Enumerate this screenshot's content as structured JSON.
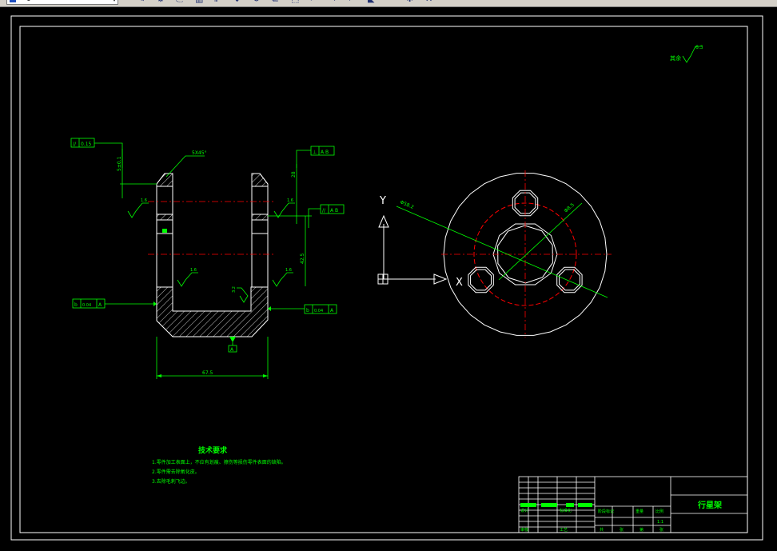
{
  "toolbar": {
    "layer_value": "0",
    "icons": [
      "pencil-icon",
      "gear-icon",
      "match-properties-icon",
      "copy-icon",
      "mirror-icon",
      "move-icon",
      "rotate-icon",
      "scale-icon",
      "stretch-icon",
      "trim-icon",
      "extend-icon",
      "break-icon",
      "chamfer-icon",
      "fillet-icon",
      "explode-icon",
      "erase-icon"
    ]
  },
  "drawing": {
    "colors": {
      "background": "#000000",
      "frame": "#ffffff",
      "dimension": "#00ff00",
      "centerline": "#ff0000",
      "hatch": "#ffffff"
    },
    "roughness_note": {
      "label": "其余",
      "value": "6.3"
    },
    "section_view": {
      "gdt_top_left": {
        "symbol": "//",
        "value": "0.15"
      },
      "gdt_top_right": {
        "symbol": "⊥",
        "value": "A B"
      },
      "gdt_mid_right": {
        "symbol": "//",
        "value": "A B"
      },
      "gdt_left": {
        "symbol": "b",
        "value": "0.04",
        "datum": "A"
      },
      "gdt_right": {
        "symbol": "b",
        "value": "0.04",
        "datum": "A"
      },
      "chamfer_label": "5X45°",
      "dim_left_height": "5±0.1",
      "dim_right_height": "28",
      "dim_right_vertical": "42.5",
      "dim_bottom_width": "67.5",
      "roughness_values": [
        "1.6",
        "1.6",
        "1.6",
        "1.6",
        "3.2"
      ],
      "datum_label": "A"
    },
    "plan_view": {
      "ucs_y": "Y",
      "ucs_x": "X",
      "dim_diameter": "Φ58.2",
      "dim_small": "Φ8.5"
    },
    "tech_requirements": {
      "title": "技术要求",
      "lines": [
        "1.零件加工表面上，不应有划痕、擦伤等损伤零件表面的缺陷。",
        "2.零件需去除氧化皮。",
        "3.去除毛刺飞边。"
      ]
    },
    "title_block": {
      "part_name": "行星架",
      "labels": [
        "标记",
        "处数",
        "分区",
        "更改文件号",
        "签名",
        "年月日",
        "设计",
        "标准化",
        "阶段标记",
        "重量",
        "比例",
        "审核",
        "工艺",
        "批准",
        "共",
        "张",
        "第",
        "张"
      ],
      "scale": "1:1"
    }
  }
}
